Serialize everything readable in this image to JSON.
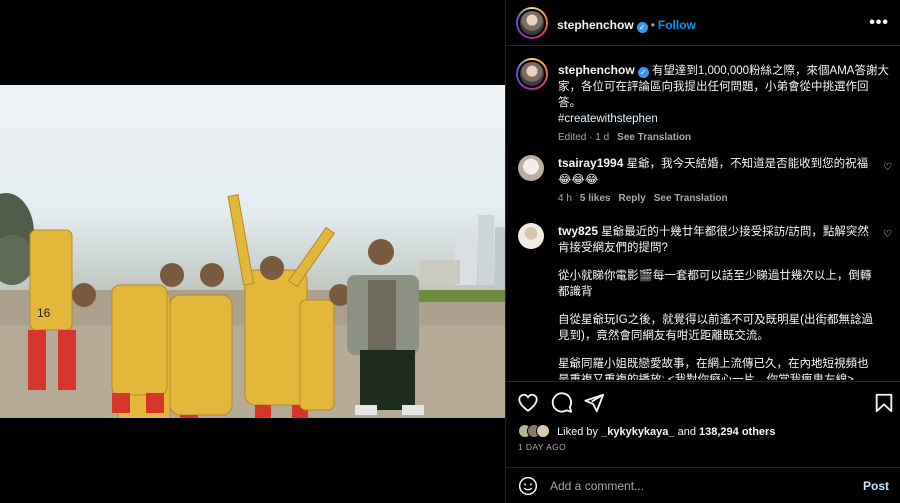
{
  "post": {
    "author": "stephenchow",
    "follow_label": "Follow",
    "dot": "•",
    "more_label": "•••",
    "verified_glyph": "✓",
    "caption_line1": "有望達到1,000,000粉絲之際，來個AMA答謝大",
    "caption_line2": "家，各位可在評論區向我提出任何問題，小弟會從中挑選作回",
    "caption_line3": "答。",
    "hashtag": "#createwithstephen",
    "edited": "Edited · 1 d",
    "see_translation": "See Translation"
  },
  "comments": [
    {
      "user": "tsairay1994",
      "line1": "星爺，我今天結婚，不知道是否能收到您的祝福",
      "line2": "😂😂😂",
      "age": "4 h",
      "likes": "5 likes",
      "reply": "Reply",
      "see_translation": "See Translation"
    },
    {
      "user": "twy825",
      "line1": "星爺最近的十幾廿年都很少接受採訪/訪問，點解突然",
      "line2": "肯接受網友們的提問?",
      "para2_line1": "從小就睇你電影🎬每一套都可以話至少睇過廿幾次以上，倒轉",
      "para2_line2": "都識背",
      "para3_line1": "自從星爺玩IG之後，就覺得以前遙不可及既明星(出街都無諗過",
      "para3_line2": "見到)，竟然會同網友有咁近距離既交流。",
      "para4_line1": "星爺同羅小姐既戀愛故事，在網上流傳已久，在內地短視頻也",
      "para4_line2": "是重複又重複的播放: <我對你癡心一片，你當我瘋鬼左線>"
    }
  ],
  "actions": {
    "heart_icon": "heart-icon",
    "comment_icon": "comment-icon",
    "share_icon": "share-icon",
    "save_icon": "bookmark-icon",
    "liked_by_prefix": "Liked by",
    "liked_by_user": "_kykykykaya_",
    "liked_by_and": "and",
    "liked_by_count": "138,294 others",
    "time_ago": "1 DAY AGO",
    "add_comment_placeholder": "Add a comment...",
    "post_label": "Post",
    "emoji_icon": "emoji-icon"
  },
  "colors": {
    "accent": "#0095f6",
    "verified": "#3897f0",
    "muted": "#a8a8a8",
    "border": "#262626",
    "uniform": "#e3b83a"
  }
}
